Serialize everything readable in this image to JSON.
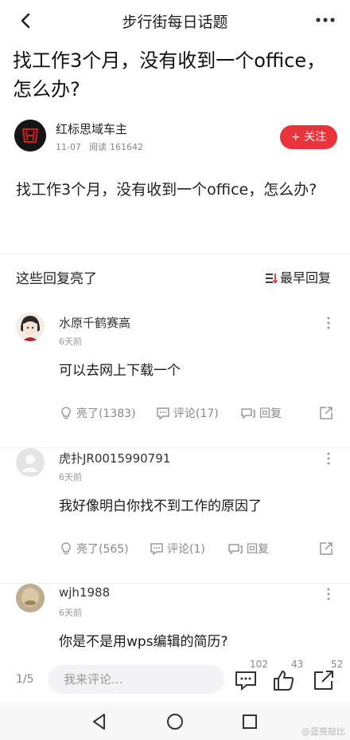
{
  "header": {
    "title": "步行街每日话题",
    "back_icon": "chevron-left-icon",
    "more_icon": "more-horizontal-icon"
  },
  "post": {
    "title": "找工作3个月，没有收到一个office，怎么办?",
    "author": {
      "name": "红标思域车主",
      "date": "11-07",
      "read_label": "阅读",
      "read_count": "161642"
    },
    "follow_label": "+ 关注",
    "body": "找工作3个月，没有收到一个office，怎么办?"
  },
  "replies_section": {
    "title": "这些回复亮了",
    "sort_label": "最早回复"
  },
  "comments": [
    {
      "name": "水原千鹤赛高",
      "time": "6天前",
      "text": "可以去网上下载一个",
      "like": "亮了(1383)",
      "comment": "评论(17)",
      "reply": "回复"
    },
    {
      "name": "虎扑JR0015990791",
      "time": "6天前",
      "text": "我好像明白你找不到工作的原因了",
      "like": "亮了(565)",
      "comment": "评论(1)",
      "reply": "回复"
    },
    {
      "name": "wjh1988",
      "time": "6天前",
      "text": "你是不是用wps编辑的简历?"
    }
  ],
  "bottom_bar": {
    "page_indicator": "1/5",
    "input_placeholder": "我来评论...",
    "comment_count": "102",
    "like_count": "43",
    "share_count": "52"
  },
  "watermark": "@蓝亮敲比",
  "colors": {
    "accent": "#e8343a",
    "text": "#1a1a1a",
    "muted": "#888888"
  }
}
